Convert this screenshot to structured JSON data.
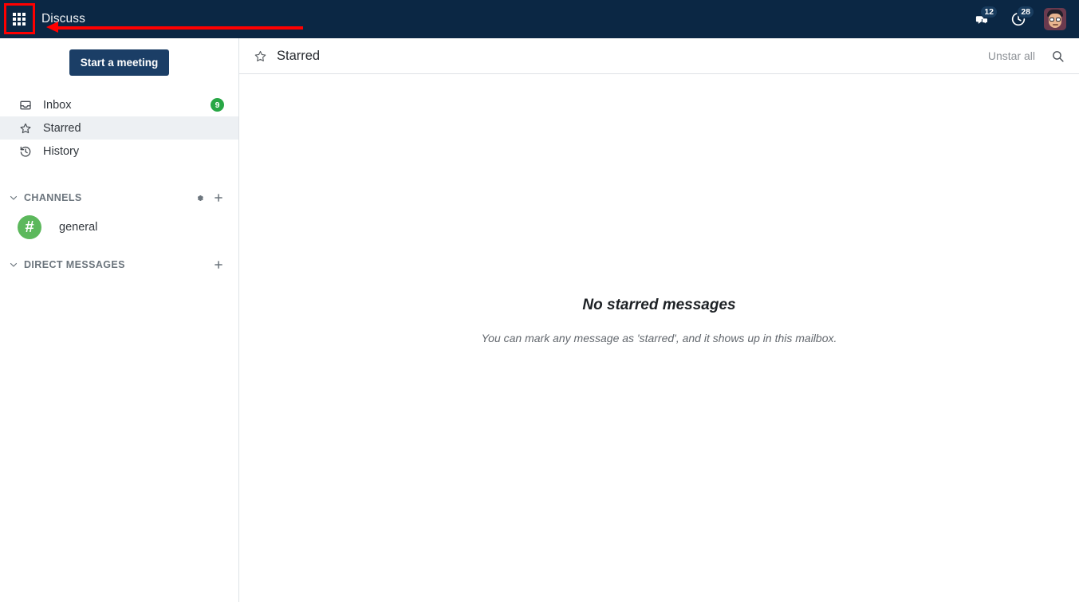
{
  "topbar": {
    "apps_icon": "grid-apps-icon",
    "brand": "Discuss",
    "messages_icon": "chat-bubble-icon",
    "messages_count": "12",
    "activity_icon": "clock-activity-icon",
    "activity_count": "28",
    "avatar_icon": "user-avatar",
    "bg_color": "#0b2744"
  },
  "annotation": {
    "highlight_color": "#ff0000",
    "target": "apps-menu-button"
  },
  "sidebar": {
    "meeting_button": "Start a meeting",
    "mailboxes": [
      {
        "label": "Inbox",
        "icon": "inbox-icon",
        "badge": "9",
        "active": false
      },
      {
        "label": "Starred",
        "icon": "star-icon",
        "badge": "",
        "active": true
      },
      {
        "label": "History",
        "icon": "history-icon",
        "badge": "",
        "active": false
      }
    ],
    "channels": {
      "title": "CHANNELS",
      "chevron_icon": "chevron-down-icon",
      "settings_icon": "gear-icon",
      "add_icon": "plus-icon",
      "items": [
        {
          "label": "general",
          "symbol": "#",
          "color": "#5cb85c"
        }
      ]
    },
    "direct_messages": {
      "title": "DIRECT MESSAGES",
      "chevron_icon": "chevron-down-icon",
      "add_icon": "plus-icon",
      "items": []
    },
    "badge_color": "#28a745",
    "button_color": "#1b3e66"
  },
  "main": {
    "header": {
      "star_icon": "star-icon",
      "title": "Starred",
      "unstar_all": "Unstar all",
      "search_icon": "search-icon"
    },
    "empty_state": {
      "title": "No starred messages",
      "subtitle": "You can mark any message as 'starred', and it shows up in this mailbox."
    }
  }
}
